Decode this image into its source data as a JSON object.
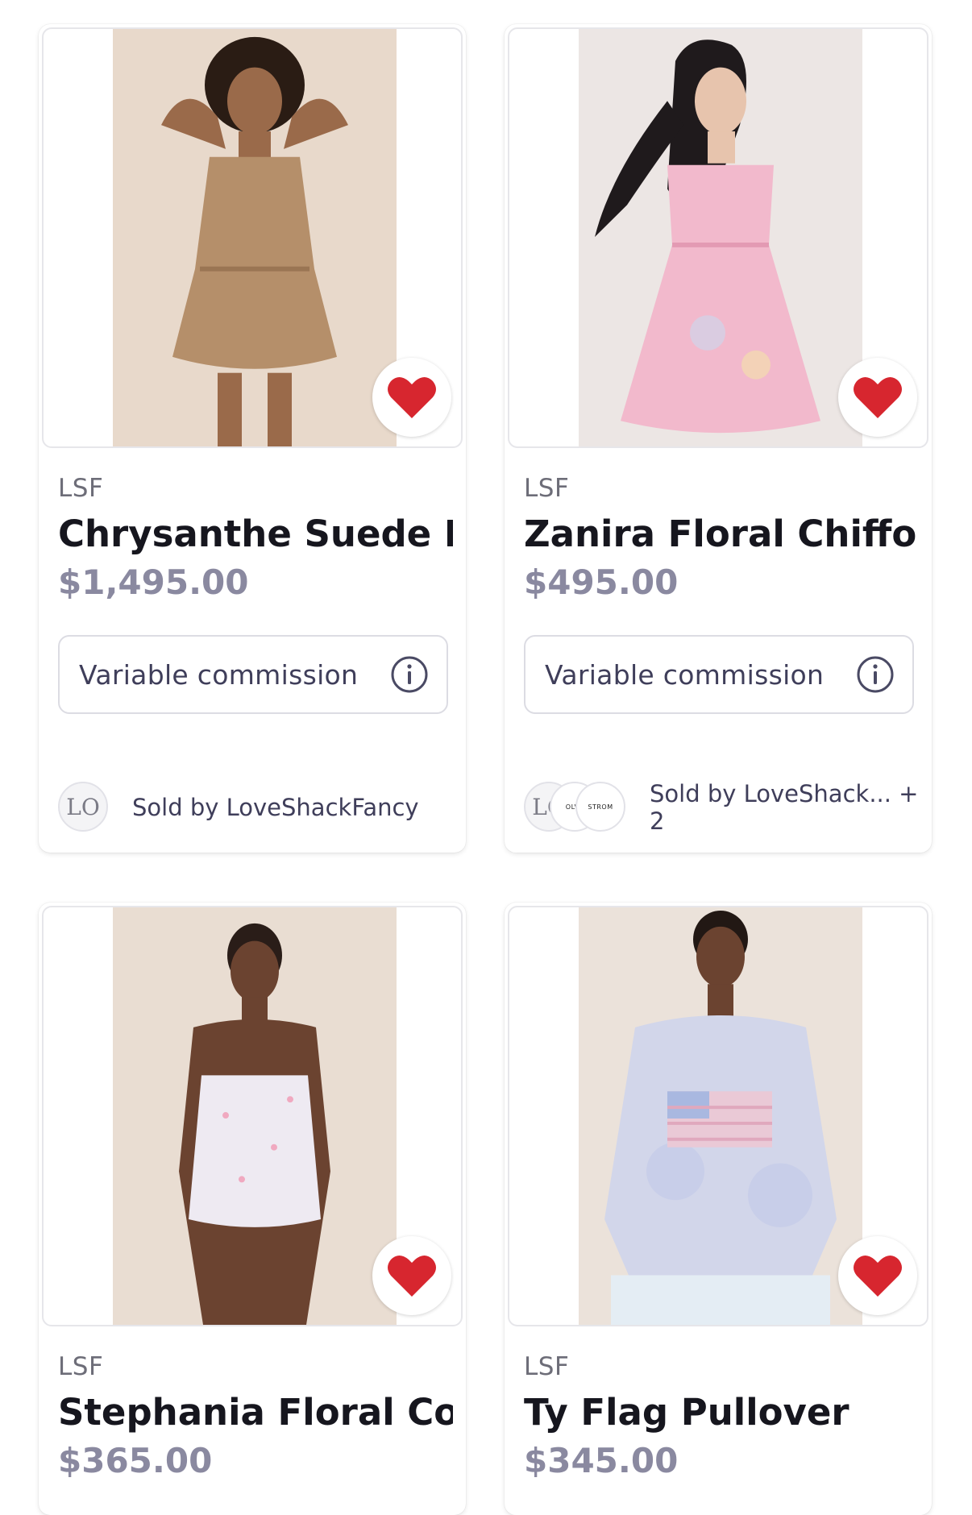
{
  "colors": {
    "heart": "#d7262f",
    "price": "#8a89a0",
    "text": "#16161e",
    "muted": "#6d6d78"
  },
  "products": [
    {
      "brand": "LSF",
      "title": "Chrysanthe Suede E...",
      "price": "$1,495.00",
      "commission": "Variable commission",
      "seller": "Sold by LoveShackFancy",
      "avatar": "LO",
      "favorited": true
    },
    {
      "brand": "LSF",
      "title": "Zanira Floral Chiffo...",
      "price": "$495.00",
      "commission": "Variable commission",
      "seller": "Sold by LoveShack... + 2",
      "avatar": "LO",
      "avatar2": "OLVE",
      "avatar3": "STROM",
      "favorited": true
    },
    {
      "brand": "LSF",
      "title": "Stephania Floral Co...",
      "price": "$365.00",
      "favorited": true
    },
    {
      "brand": "LSF",
      "title": "Ty Flag Pullover",
      "price": "$345.00",
      "favorited": true
    }
  ]
}
